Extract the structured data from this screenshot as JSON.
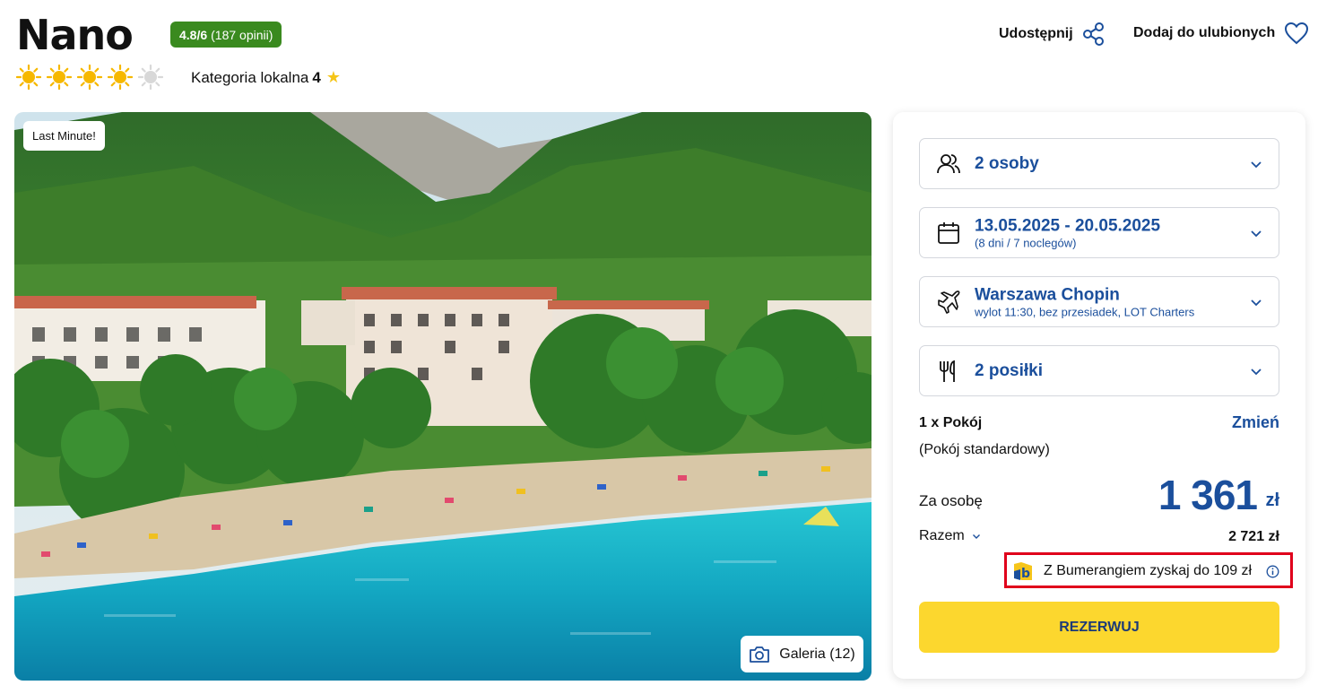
{
  "hotel": {
    "name": "Nano",
    "rating": "4.8/6",
    "reviews": "(187 opinii)",
    "sun_rating": 4,
    "sun_max": 5,
    "local_category_label": "Kategoria lokalna",
    "local_category_value": "4"
  },
  "actions": {
    "share_label": "Udostępnij",
    "favorite_label": "Dodaj do ulubionych"
  },
  "photo": {
    "badge": "Last Minute!",
    "gallery_label": "Galeria (12)"
  },
  "booking": {
    "persons": {
      "value": "2 osoby",
      "icon": "users-icon"
    },
    "dates": {
      "value": "13.05.2025 - 20.05.2025",
      "detail": "(8 dni / 7 noclegów)",
      "icon": "calendar-icon"
    },
    "flight": {
      "value": "Warszawa Chopin",
      "detail": "wylot 11:30, bez przesiadek, LOT Charters",
      "icon": "plane-icon"
    },
    "meals": {
      "value": "2 posiłki",
      "icon": "cutlery-icon"
    },
    "room_count": "1 x Pokój",
    "room_change": "Zmień",
    "room_type": "(Pokój standardowy)",
    "per_person_label": "Za osobę",
    "per_person_price": "1 361",
    "currency": "zł",
    "total_label": "Razem",
    "total_value": "2 721 zł",
    "bumerang_text": "Z Bumerangiem zyskaj do 109 zł",
    "reserve_label": "REZERWUJ"
  },
  "colors": {
    "brand_blue": "#1b4f9c",
    "rating_green": "#3a8a1f",
    "reserve_yellow": "#fcd72e",
    "highlight_red": "#e0001b",
    "sun_active": "#f6b800",
    "sun_inactive": "#d8d8d8"
  }
}
